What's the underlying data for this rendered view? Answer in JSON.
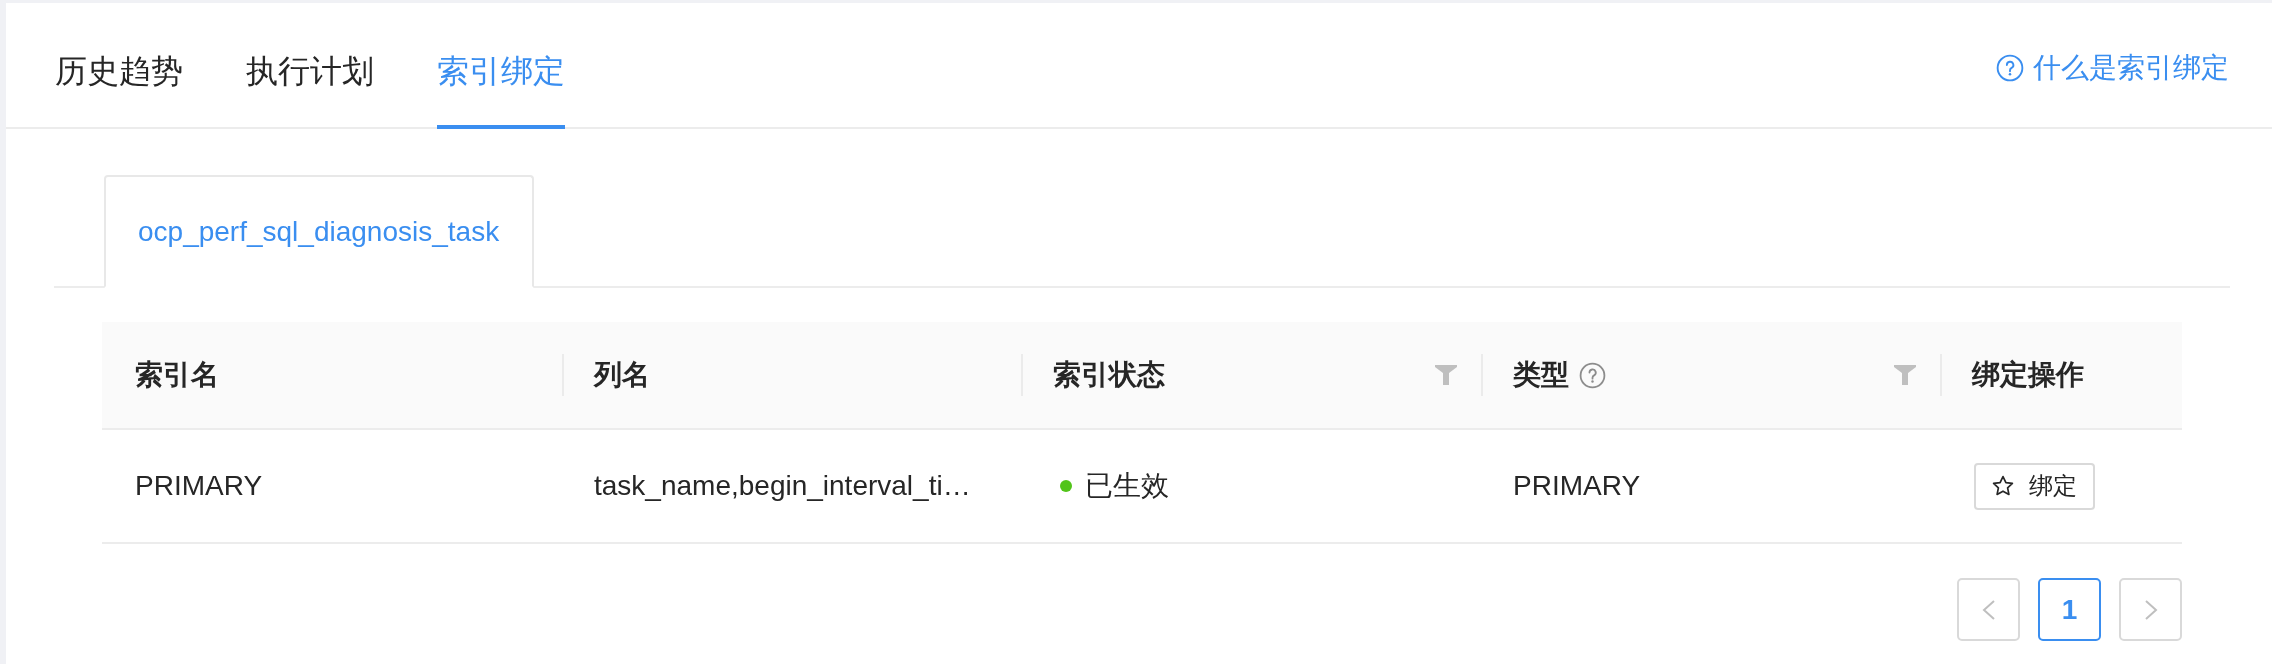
{
  "tabs": [
    {
      "label": "历史趋势",
      "selected": false
    },
    {
      "label": "执行计划",
      "selected": false
    },
    {
      "label": "索引绑定",
      "selected": true
    }
  ],
  "help_link": {
    "label": "什么是索引绑定"
  },
  "table_tabs": [
    {
      "label": "ocp_perf_sql_diagnosis_task",
      "selected": true
    }
  ],
  "table": {
    "columns": [
      {
        "label": "索引名",
        "filter": false,
        "help": false
      },
      {
        "label": "列名",
        "filter": false,
        "help": false
      },
      {
        "label": "索引状态",
        "filter": true,
        "help": false
      },
      {
        "label": "类型",
        "filter": true,
        "help": true
      },
      {
        "label": "绑定操作",
        "filter": false,
        "help": false
      }
    ],
    "rows": [
      {
        "index_name": "PRIMARY",
        "column_names": "task_name,begin_interval_ti…",
        "status": {
          "label": "已生效",
          "color": "#52c41a"
        },
        "type": "PRIMARY",
        "action": {
          "label": "绑定"
        }
      }
    ]
  },
  "pagination": {
    "prev": {
      "disabled": true
    },
    "pages": [
      {
        "label": "1",
        "selected": true
      }
    ],
    "next": {
      "disabled": true
    }
  }
}
